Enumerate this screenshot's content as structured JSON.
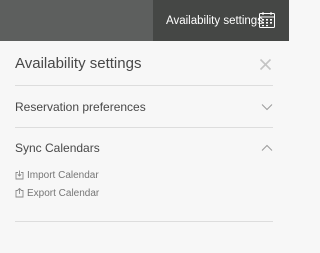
{
  "topbar": {
    "tab_label": "Availability settings",
    "tab_icon": "calendar-icon"
  },
  "panel": {
    "title": "Availability settings",
    "close_icon": "close-icon",
    "sections": [
      {
        "label": "Reservation preferences",
        "state": "collapsed",
        "icon": "chevron-down-icon"
      },
      {
        "label": "Sync Calendars",
        "state": "expanded",
        "icon": "chevron-up-icon",
        "items": [
          {
            "label": "Import Calendar",
            "icon": "import-icon"
          },
          {
            "label": "Export Calendar",
            "icon": "export-icon"
          }
        ]
      }
    ]
  },
  "colors": {
    "topbar": "#5d5f5e",
    "topbar_active_tab": "#454745",
    "panel_bg": "#f7f7f7",
    "text": "#484848",
    "muted_text": "#767676",
    "divider": "#dddddd"
  }
}
